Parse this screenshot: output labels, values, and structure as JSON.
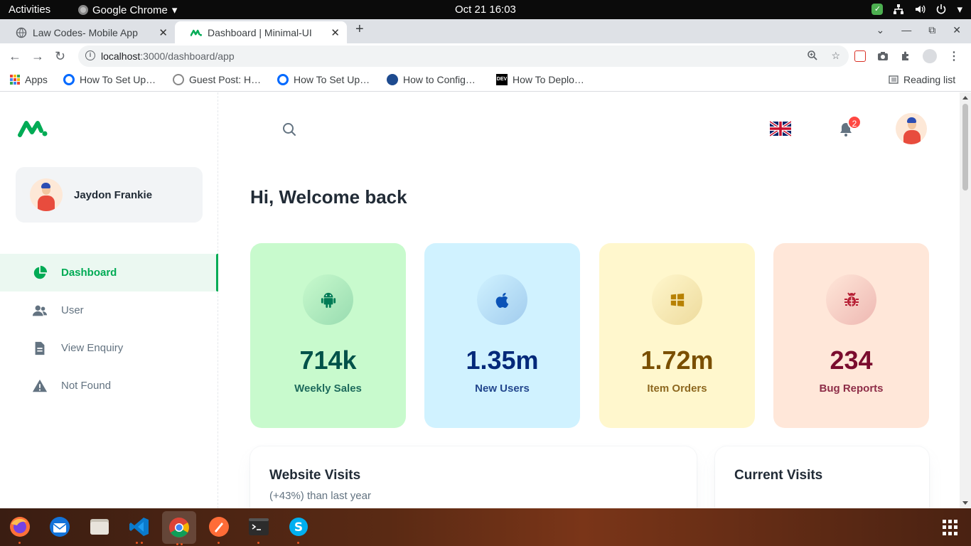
{
  "system": {
    "activities": "Activities",
    "app_name": "Google Chrome",
    "clock": "Oct 21  16:03"
  },
  "browser": {
    "tabs": [
      {
        "title": "Law Codes- Mobile App",
        "active": false
      },
      {
        "title": "Dashboard | Minimal-UI",
        "active": true
      }
    ],
    "url_host": "localhost",
    "url_path": ":3000/dashboard/app",
    "bookmarks": [
      {
        "label": "Apps"
      },
      {
        "label": "How To Set Up…"
      },
      {
        "label": "Guest Post: H…"
      },
      {
        "label": "How To Set Up…"
      },
      {
        "label": "How to Config…"
      },
      {
        "label": "How To Deplo…"
      }
    ],
    "reading_list": "Reading list"
  },
  "sidebar": {
    "account_name": "Jaydon Frankie",
    "items": [
      {
        "label": "Dashboard",
        "icon": "pie-chart-icon",
        "active": true
      },
      {
        "label": "User",
        "icon": "people-icon",
        "active": false
      },
      {
        "label": "View Enquiry",
        "icon": "file-text-icon",
        "active": false
      },
      {
        "label": "Not Found",
        "icon": "alert-triangle-icon",
        "active": false
      }
    ]
  },
  "header": {
    "notification_count": "2",
    "language_flag": "uk-flag-icon"
  },
  "main": {
    "welcome": "Hi, Welcome back",
    "cards": [
      {
        "value": "714k",
        "label": "Weekly Sales",
        "icon": "android-icon",
        "color": "#005249"
      },
      {
        "value": "1.35m",
        "label": "New Users",
        "icon": "apple-icon",
        "color": "#04297a"
      },
      {
        "value": "1.72m",
        "label": "Item Orders",
        "icon": "windows-icon",
        "color": "#7a4f01"
      },
      {
        "value": "234",
        "label": "Bug Reports",
        "icon": "bug-icon",
        "color": "#7a0c2e"
      }
    ],
    "website_visits": {
      "title": "Website Visits",
      "subtitle": "(+43%) than last year"
    },
    "current_visits": {
      "title": "Current Visits"
    }
  },
  "colors": {
    "primary": "#00ab55",
    "text_primary": "#212b36",
    "text_secondary": "#637381"
  }
}
